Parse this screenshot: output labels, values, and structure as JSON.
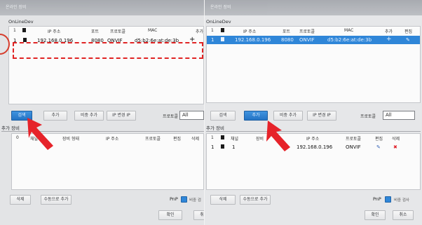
{
  "left": {
    "title": "온라인 장비",
    "online_section": "OnLineDev",
    "online_columns": [
      "1",
      "",
      "IP 주소",
      "포트",
      "프로토콜",
      "MAC",
      "추가"
    ],
    "online_rows": [
      {
        "index": "1",
        "ip": "192.168.0.196",
        "port": "8080",
        "protocol": "ONVIF",
        "mac": "d5:b2:6e:at:de:3b",
        "add": "+"
      }
    ],
    "buttons": {
      "search": "검색",
      "add": "추가",
      "manual_add": "비중 추가",
      "change_ip": "IP 변경 IP"
    },
    "protocol_label": "프로토콜",
    "protocol_value": "All",
    "added_section": "추가 장비",
    "added_columns": [
      "0",
      "채널",
      "장비 형태",
      "IP 주소",
      "프로토콜",
      "편집",
      "삭제"
    ],
    "bottom_buttons": {
      "delete": "삭제",
      "manual": "수동으로 추가"
    },
    "pnp_label": "PnP",
    "pnp_extra": "비중 검",
    "confirm": "확인",
    "cancel": "취"
  },
  "right": {
    "title": "온라인 장비",
    "online_section": "OnLineDev",
    "online_columns": [
      "1",
      "",
      "IP 주소",
      "포트",
      "프로토콜",
      "MAC",
      "추가",
      "편집"
    ],
    "online_rows": [
      {
        "index": "1",
        "ip": "192.168.0.196",
        "port": "8080",
        "protocol": "ONVIF",
        "mac": "d5:b2:6e:at:de:3b",
        "add": "+",
        "edit": "✎"
      }
    ],
    "buttons": {
      "search": "검색",
      "add": "추가",
      "manual_add": "비중 추가",
      "change_ip": "IP 변경 IP"
    },
    "protocol_label": "프로토콜",
    "protocol_value": "All",
    "added_section": "추가 장비",
    "added_columns": [
      "1",
      "",
      "채널",
      "장비",
      "IP 주소",
      "프로토콜",
      "편집",
      "삭제"
    ],
    "added_rows": [
      {
        "index": "1",
        "channel": "1",
        "ip": "192.168.0.196",
        "protocol": "ONVIF",
        "edit": "✎",
        "delete": "✖"
      }
    ],
    "bottom_buttons": {
      "delete": "삭제",
      "manual": "수동으로 추가"
    },
    "pnp_label": "PnP",
    "pnp_extra": "비중 검사",
    "confirm": "확인",
    "cancel": "취소"
  }
}
